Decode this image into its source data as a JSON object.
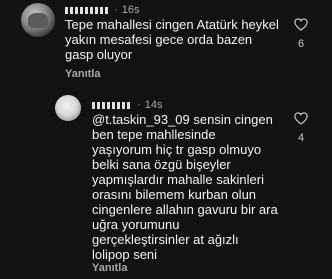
{
  "comments": [
    {
      "username_mask": "",
      "separator": "·",
      "time": "16s",
      "lines": [
        "Tepe mahallesi cingen Atatürk heykel",
        "yakın mesafesi gece orda bazen",
        "gasp oluyor"
      ],
      "reply_label": "Yanıtla",
      "like_count": "6"
    },
    {
      "username_mask": "",
      "separator": "·",
      "time": "14s",
      "lines": [
        "@t.taskin_93_09 sensin cingen",
        "ben tepe mahllesinde",
        "yaşıyorum hiç tr gasp olmuyo",
        "belki sana özgü bişeyler",
        "yapmışlardır mahalle sakinleri",
        "orasını bilemem kurban olun",
        "cingenlere allahın gavuru bir ara",
        "uğra yorumunu",
        "gerçekleştirsinler at ağızlı",
        "lolipop seni"
      ],
      "reply_label": "Yanıtla",
      "like_count": "4"
    }
  ],
  "icons": {
    "heart": "heart-outline-icon"
  }
}
